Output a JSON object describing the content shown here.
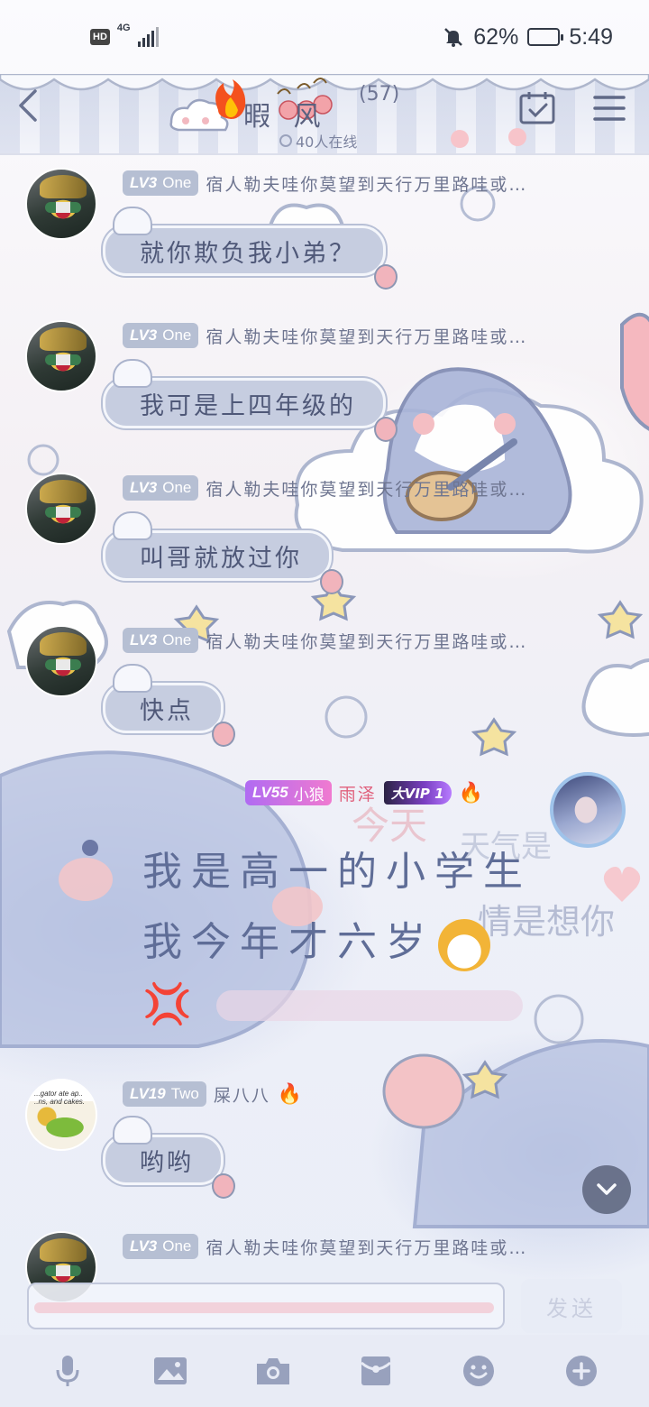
{
  "status_bar": {
    "hd": "HD",
    "network": "4G",
    "battery_percent": "62%",
    "battery_level": 0.62,
    "time": "5:49"
  },
  "header": {
    "title": "暇 风",
    "member_count": "(57)",
    "online_status": "40人在线"
  },
  "messages": [
    {
      "level": "LV3",
      "level_name": "One",
      "nickname": "宿人勒夫哇你莫望到天行万里路哇或…",
      "text": "就你欺负我小弟？"
    },
    {
      "level": "LV3",
      "level_name": "One",
      "nickname": "宿人勒夫哇你莫望到天行万里路哇或…",
      "text": "我可是上四年级的"
    },
    {
      "level": "LV3",
      "level_name": "One",
      "nickname": "宿人勒夫哇你莫望到天行万里路哇或…",
      "text": "叫哥就放过你"
    },
    {
      "level": "LV3",
      "level_name": "One",
      "nickname": "宿人勒夫哇你莫望到天行万里路哇或…",
      "text": "快点"
    }
  ],
  "self_message": {
    "level": "LV55",
    "level_name": "小狼",
    "nickname": "雨泽",
    "vip": "大VIP 1",
    "line1": "我是高一的小学生",
    "line2": "我今年才六岁",
    "anger_emoji": "💢"
  },
  "message_two": {
    "level": "LV19",
    "level_name": "Two",
    "nickname": "屎八八",
    "avatar_caption": "...gator ate ap.. ..ns, and cakes.",
    "text": "哟哟"
  },
  "last_message": {
    "level": "LV3",
    "level_name": "One",
    "nickname": "宿人勒夫哇你莫望到天行万里路哇或…"
  },
  "input": {
    "send_label": "发送"
  },
  "icons": {
    "back": "back-arrow-icon",
    "checkin": "calendar-check-icon",
    "menu": "hamburger-menu-icon",
    "tools": [
      "microphone-icon",
      "image-icon",
      "camera-icon",
      "red-packet-icon",
      "emoji-icon",
      "plus-icon"
    ]
  }
}
